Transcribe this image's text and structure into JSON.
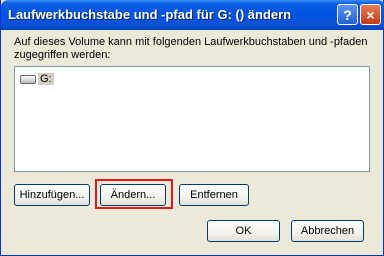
{
  "window": {
    "title": "Laufwerkbuchstabe und -pfad für G: () ändern",
    "help_label": "?",
    "close_label": "×"
  },
  "description": "Auf dieses Volume kann mit folgenden Laufwerkbuchstaben und -pfaden zugegriffen werden:",
  "list": {
    "items": [
      {
        "label": "G:",
        "icon": "drive-icon"
      }
    ]
  },
  "buttons": {
    "add": "Hinzufügen...",
    "change": "Ändern...",
    "remove": "Entfernen",
    "ok": "OK",
    "cancel": "Abbrechen"
  },
  "highlight_color": "#e8141c"
}
